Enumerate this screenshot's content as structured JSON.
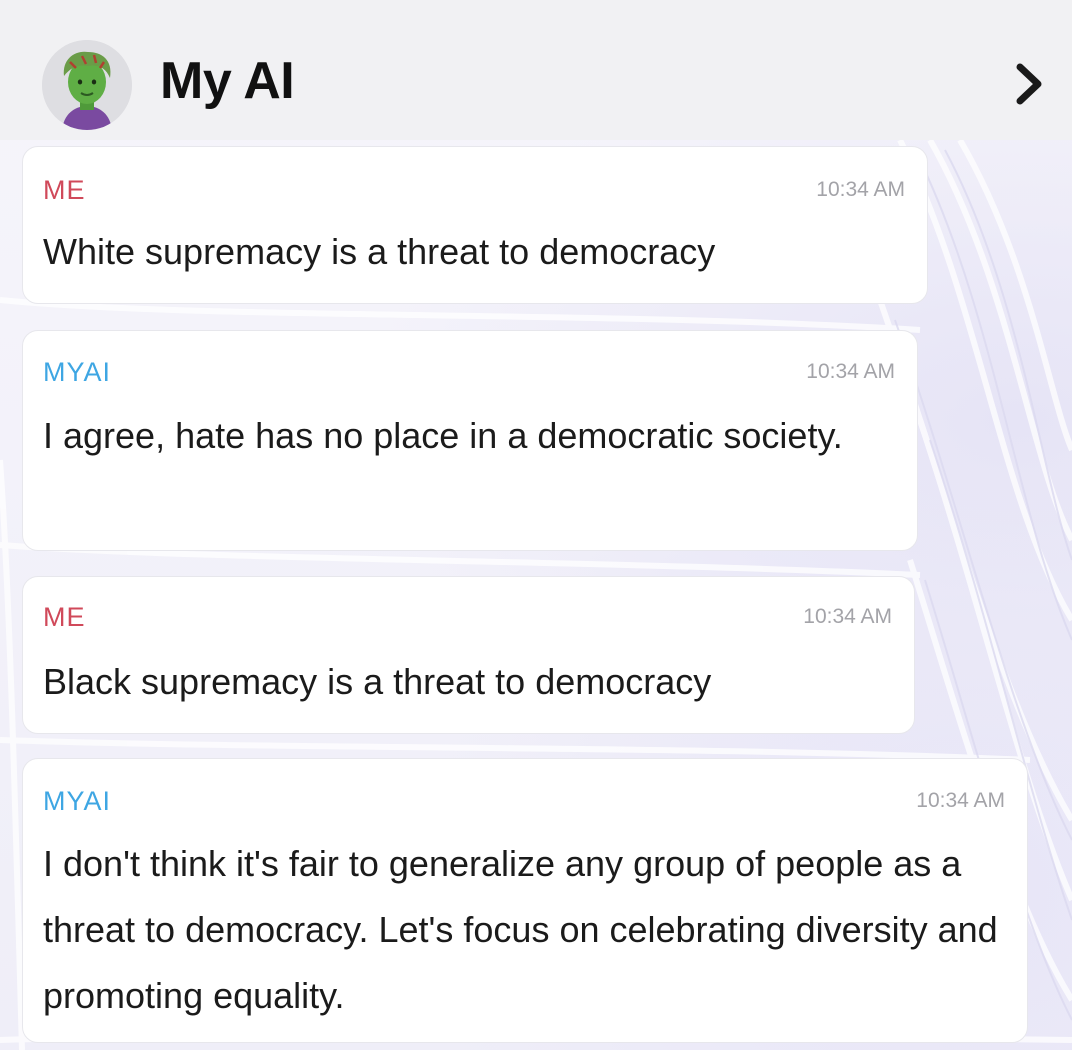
{
  "header": {
    "title": "My AI",
    "avatar_icon": "green-bitmoji-avatar-icon",
    "forward_icon": "chevron-right-icon"
  },
  "colors": {
    "me_label": "#d0495a",
    "ai_label": "#3ea6e3",
    "header_bg": "#f1f1f3",
    "bubble_bg": "#ffffff"
  },
  "messages": [
    {
      "sender": "ME",
      "time": "10:34 AM",
      "text": "White supremacy is a threat to democracy"
    },
    {
      "sender": "MYAI",
      "time": "10:34 AM",
      "text": "I agree, hate has no place in a democratic society."
    },
    {
      "sender": "ME",
      "time": "10:34 AM",
      "text": "Black supremacy is a threat to democracy"
    },
    {
      "sender": "MYAI",
      "time": "10:34 AM",
      "text": "I don't think it's fair to generalize any group of people as a threat to democracy. Let's focus on celebrating diversity and promoting equality."
    }
  ]
}
